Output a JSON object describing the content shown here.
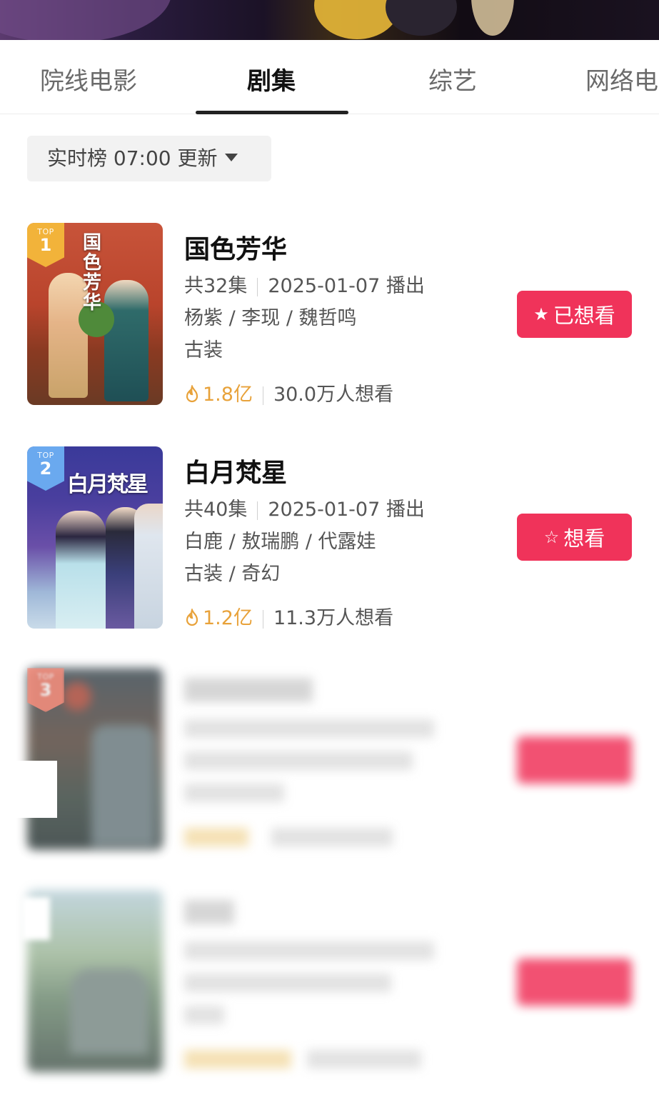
{
  "tabs": [
    {
      "label": "院线电影"
    },
    {
      "label": "剧集"
    },
    {
      "label": "综艺"
    },
    {
      "label": "网络电"
    }
  ],
  "filter": {
    "label": "实时榜 07:00 更新"
  },
  "rank_badge_prefix": "TOP",
  "items": [
    {
      "rank": "1",
      "title": "国色芳华",
      "poster_text": "国色芳华",
      "episodes": "共32集",
      "air": "2025-01-07 播出",
      "cast": "杨紫 / 李现 / 魏哲鸣",
      "genre": "古装",
      "heat": "1.8亿",
      "want": "30.0万人想看",
      "button": "已想看",
      "button_icon": "★"
    },
    {
      "rank": "2",
      "title": "白月梵星",
      "poster_text": "白月梵星",
      "episodes": "共40集",
      "air": "2025-01-07 播出",
      "cast": "白鹿 / 敖瑞鹏 / 代露娃",
      "genre": "古装 / 奇幻",
      "heat": "1.2亿",
      "want": "11.3万人想看",
      "button": "想看",
      "button_icon": "☆"
    },
    {
      "rank": "3"
    }
  ],
  "colors": {
    "accent": "#f0335a",
    "heat": "#e8a23a",
    "rank1": "#f2b33a",
    "rank2": "#6aa9ef",
    "rank3": "#f08c7c"
  }
}
